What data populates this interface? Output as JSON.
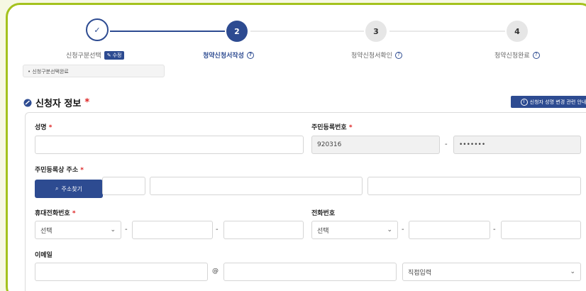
{
  "stepper": {
    "steps": [
      {
        "number": "✓",
        "label": "신청구분선택",
        "badge": "수정"
      },
      {
        "number": "2",
        "label": "청약신청서작성"
      },
      {
        "number": "3",
        "label": "청약신청서확인"
      },
      {
        "number": "4",
        "label": "청약신청완료"
      }
    ],
    "selected_tag": "• 신청구분선택완료"
  },
  "section": {
    "title": "신청자 정보",
    "required_mark": "*",
    "notice_button": "신청자 성명 변경 관련 안내"
  },
  "form": {
    "name_label": "성명",
    "rrn_label": "주민등록번호",
    "rrn_front": "920316",
    "rrn_dash": "-",
    "rrn_back": "•••••••",
    "address_label": "주민등록상 주소",
    "address_search": "주소찾기",
    "mobile_label": "휴대전화번호",
    "mobile_select": "선택",
    "phone_label": "전화번호",
    "phone_select": "선택",
    "dash": "-",
    "email_label": "이메일",
    "email_at": "@",
    "email_domain_select": "직접입력",
    "required_mark": "*"
  },
  "colors": {
    "primary": "#2d4b91",
    "frame_border": "#a4c21d",
    "required": "#d22222"
  }
}
